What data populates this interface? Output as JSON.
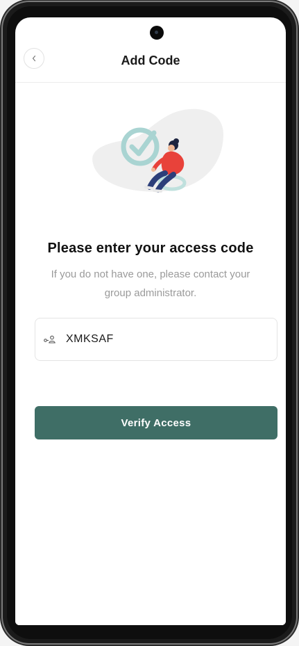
{
  "header": {
    "title": "Add Code",
    "back_icon": "chevron-left-icon"
  },
  "main": {
    "heading": "Please enter your access code",
    "subtext": "If you do not have one, please contact your group administrator.",
    "code_field": {
      "icon": "key-person-icon",
      "value": "XMKSAF"
    },
    "verify_button_label": "Verify Access"
  },
  "colors": {
    "accent": "#3f6e66",
    "illustration_check": "#a9d4d2",
    "illustration_person_shirt": "#e8423a",
    "illustration_person_pants": "#2c3f7a",
    "illustration_blob": "#efefef"
  }
}
